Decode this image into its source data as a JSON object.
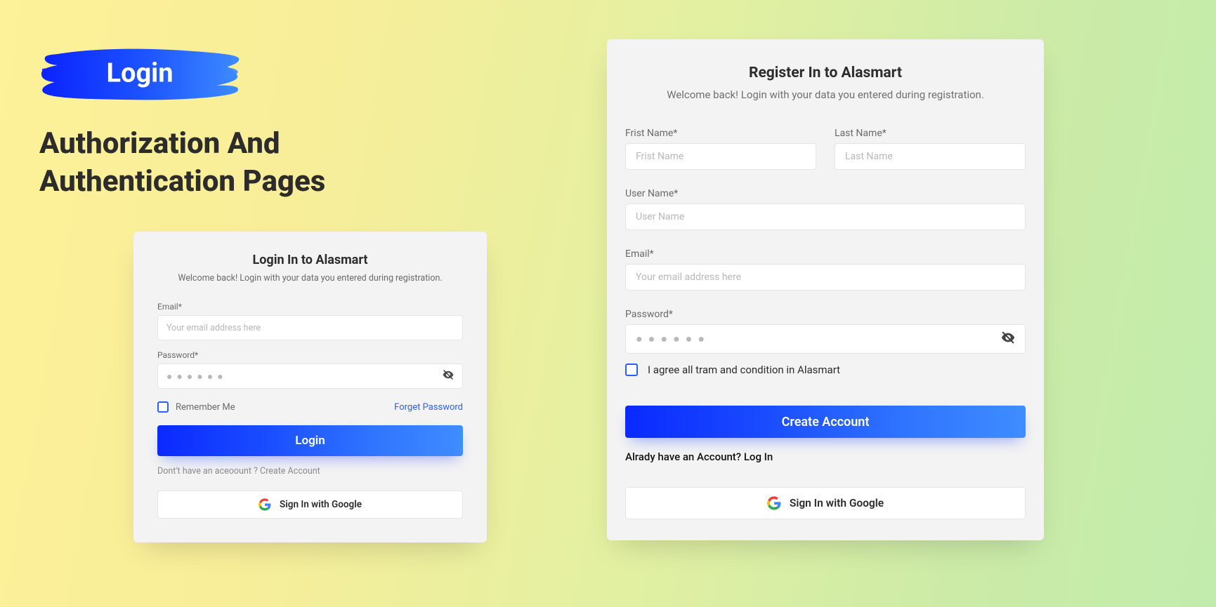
{
  "header": {
    "brush_label": "Login",
    "heading": "Authorization And Authentication Pages"
  },
  "login": {
    "title": "Login In to Alasmart",
    "subtitle": "Welcome back! Login with your data you entered during registration.",
    "email_label": "Email*",
    "email_placeholder": "Your email address here",
    "password_label": "Password*",
    "remember_label": "Remember Me",
    "forget_label": "Forget Password",
    "submit_label": "Login",
    "create_line": "Dont't have an aceoount ? Create Account",
    "google_label": "Sign In with Google"
  },
  "register": {
    "title": "Register In to Alasmart",
    "subtitle": "Welcome back! Login with your data you entered during registration.",
    "first_name_label": "Frist Name*",
    "first_name_placeholder": "Frist Name",
    "last_name_label": "Last Name*",
    "last_name_placeholder": "Last Name",
    "user_name_label": "User Name*",
    "user_name_placeholder": "User Name",
    "email_label": "Email*",
    "email_placeholder": "Your email address here",
    "password_label": "Password*",
    "agree_label": "I agree all tram and condition in Alasmart",
    "submit_label": "Create Account",
    "have_line": "Alrady have an Account? Log In",
    "google_label": "Sign In with Google"
  }
}
